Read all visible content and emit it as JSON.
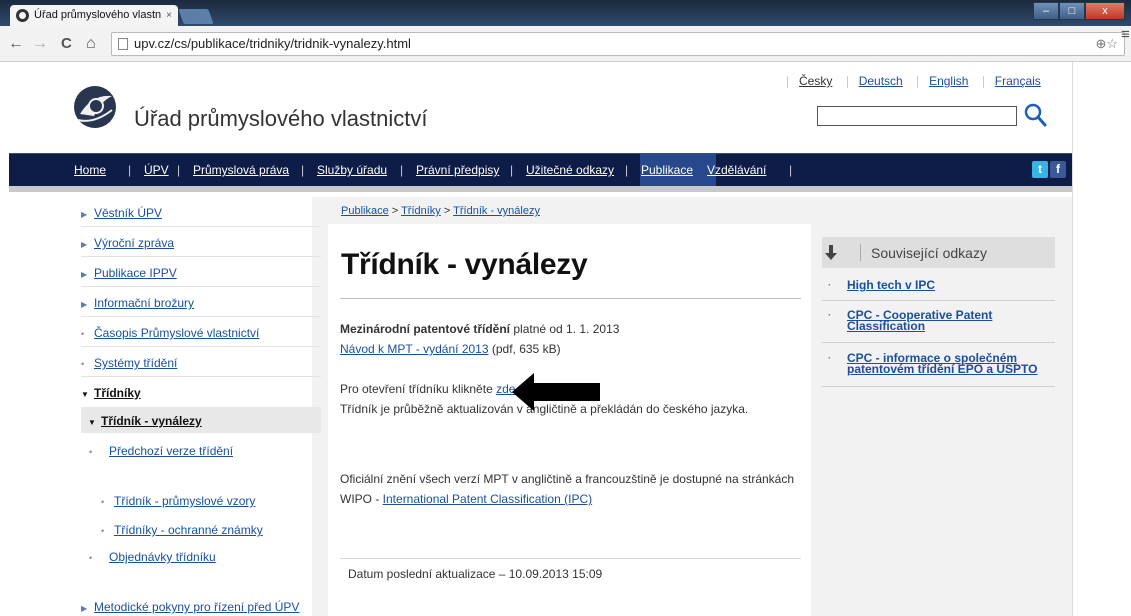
{
  "browser": {
    "tab_title": "Úřad průmyslového vlastn",
    "tab_close": "×",
    "url": "upv.cz/cs/publikace/tridniky/tridnik-vynalezy.html",
    "window_buttons": [
      "–",
      "□",
      "x"
    ],
    "nav": {
      "back": "←",
      "forward": "→",
      "reload": "C",
      "home": "⌂"
    },
    "omni_icons": "⊕☆",
    "menu_icon": "≡"
  },
  "header": {
    "site_title": "Úřad průmyslového vlastnictví",
    "languages": [
      "Česky",
      "Deutsch",
      "English",
      "Français"
    ]
  },
  "mainnav": {
    "items": [
      "Home",
      "ÚPV",
      "Průmyslová práva",
      "Služby úřadu",
      "Právní předpisy",
      "Užitečné odkazy",
      "Publikace",
      "Vzdělávání"
    ],
    "active": "Publikace",
    "social": [
      "t",
      "f"
    ]
  },
  "leftnav": {
    "items": [
      {
        "label": "Věstník ÚPV",
        "marker": "▶"
      },
      {
        "label": "Výroční zpráva",
        "marker": "▶"
      },
      {
        "label": "Publikace IPPV",
        "marker": "▶"
      },
      {
        "label": "Informační brožury",
        "marker": "▶"
      },
      {
        "label": "Časopis Průmyslové vlastnictví",
        "marker": "•"
      },
      {
        "label": "Systémy třídění",
        "marker": "•"
      },
      {
        "label": "Třídníky",
        "marker": "▼"
      },
      {
        "label": "Třídník - vynálezy",
        "marker": "▼"
      },
      {
        "label": "Předchozí verze třídění",
        "marker": "•"
      },
      {
        "label": "Třídník - průmyslové vzory",
        "marker": "•"
      },
      {
        "label": "Třídníky - ochranné známky",
        "marker": "•"
      },
      {
        "label": "Objednávky třídníku",
        "marker": "•"
      },
      {
        "label": "Metodické pokyny pro řízení před ÚPV",
        "marker": "▶"
      }
    ]
  },
  "breadcrumb": [
    "Publikace",
    "Třídníky",
    "Třídník - vynálezy"
  ],
  "breadcrumb_sep": ">",
  "main": {
    "title": "Třídník - vynálezy",
    "mpt_bold": "Mezinárodní patentové třídění",
    "mpt_rest": " platné od 1. 1. 2013",
    "guide_link": "Návod k MPT - vydání 2013",
    "guide_rest": " (pdf, 635 kB)",
    "open_text": "Pro otevření třídníku klikněte ",
    "open_link": "zde",
    "update_note": "Třídník je průběžně aktualizován v angličtině a překládán do českého jazyka.",
    "official_line1": "Oficiální znění všech verzí MPT v angličtině a francouzštině je dostupné na stránkách",
    "official_prefix": "WIPO - ",
    "official_link": "International Patent Classification (IPC)",
    "last_update": "Datum poslední aktualizace – 10.09.2013 15:09"
  },
  "related": {
    "heading": "Související odkazy",
    "links": [
      {
        "line1": "High tech v IPC",
        "line2": ""
      },
      {
        "line1": "CPC - Cooperative Patent",
        "line2": "Classification"
      },
      {
        "line1": "CPC - informace o společném",
        "line2": "patentovém třídění EPO a USPTO"
      }
    ],
    "bullet": "·"
  }
}
